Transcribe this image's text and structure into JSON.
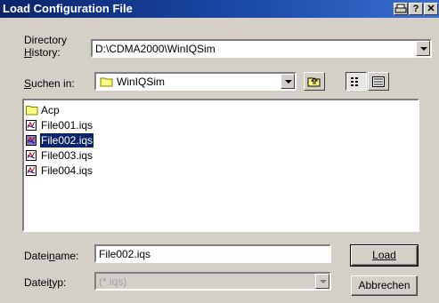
{
  "window": {
    "title": "Load Configuration File"
  },
  "directory_history": {
    "label_line1": "Directory",
    "label_line2": "History:",
    "value": "D:\\CDMA2000\\WinIQSim"
  },
  "look_in": {
    "label": "Suchen in:",
    "value": "WinIQSim"
  },
  "file_list": {
    "items": [
      {
        "name": "Acp",
        "type": "folder"
      },
      {
        "name": "File001.iqs",
        "type": "file"
      },
      {
        "name": "File002.iqs",
        "type": "file",
        "selected": true
      },
      {
        "name": "File003.iqs",
        "type": "file"
      },
      {
        "name": "File004.iqs",
        "type": "file"
      }
    ]
  },
  "filename": {
    "label": "Dateiname:",
    "value": "File002.iqs"
  },
  "filetype": {
    "label": "Dateityp:",
    "value": "(*.iqs)"
  },
  "buttons": {
    "load": "Load",
    "cancel": "Abbrechen"
  }
}
